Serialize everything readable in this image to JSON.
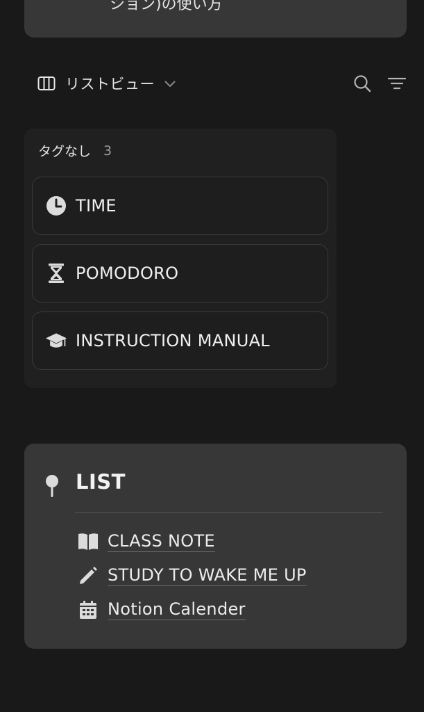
{
  "top_callout": {
    "text": "ション)の使い方"
  },
  "view_bar": {
    "view_label": "リストビュー",
    "icons": [
      "board-view-icon",
      "chevron-down-icon",
      "search-icon",
      "filter-icon"
    ]
  },
  "group": {
    "name": "タグなし",
    "count": "3",
    "cards": [
      {
        "title": "TIME",
        "icon": "clock-icon"
      },
      {
        "title": "POMODORO",
        "icon": "hourglass-icon"
      },
      {
        "title": "INSTRUCTION MANUAL",
        "icon": "graduation-cap-icon"
      }
    ]
  },
  "list_callout": {
    "icon": "pin-icon",
    "title": "LIST",
    "links": [
      {
        "label": "CLASS NOTE",
        "icon": "book-icon"
      },
      {
        "label": "STUDY TO WAKE ME UP",
        "icon": "pencil-icon"
      },
      {
        "label": "Notion Calender",
        "icon": "calendar-icon"
      }
    ]
  },
  "colors": {
    "background": "#191919",
    "callout": "#373737",
    "group": "#202020",
    "card_border": "#3a3a3a",
    "text": "#e6e6e6",
    "muted": "#9b9b9b"
  }
}
